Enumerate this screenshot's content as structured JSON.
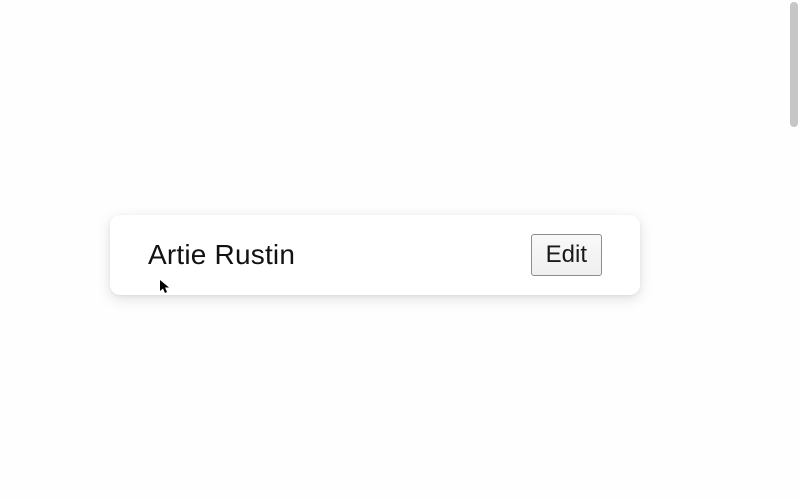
{
  "card": {
    "name": "Artie Rustin",
    "edit_label": "Edit"
  }
}
